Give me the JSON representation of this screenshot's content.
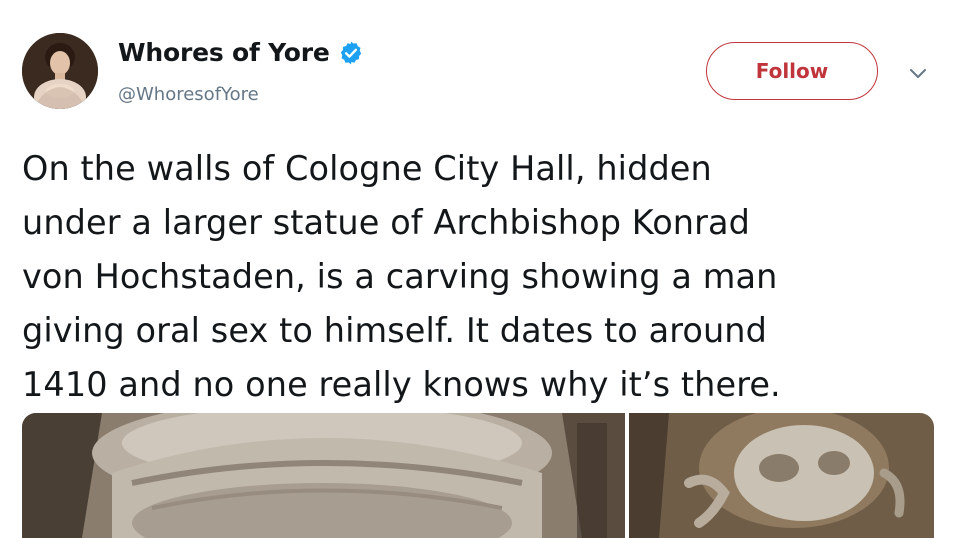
{
  "user": {
    "display_name": "Whores of Yore",
    "handle": "@WhoresofYore",
    "verified": true,
    "avatar_icon": "portrait-avatar"
  },
  "actions": {
    "follow_label": "Follow",
    "menu_icon": "chevron-down-icon"
  },
  "tweet": {
    "lines": [
      "On the walls of Cologne City Hall, hidden",
      "under a larger statue of Archbishop Konrad",
      "von Hochstaden,  is a carving showing a man",
      "giving oral sex to himself. It dates to around",
      "1410 and no one really knows why it’s there."
    ]
  },
  "colors": {
    "follow_accent": "#c0353b",
    "verified_blue": "#1da1f2",
    "text_primary": "#14171a",
    "text_secondary": "#657786"
  }
}
